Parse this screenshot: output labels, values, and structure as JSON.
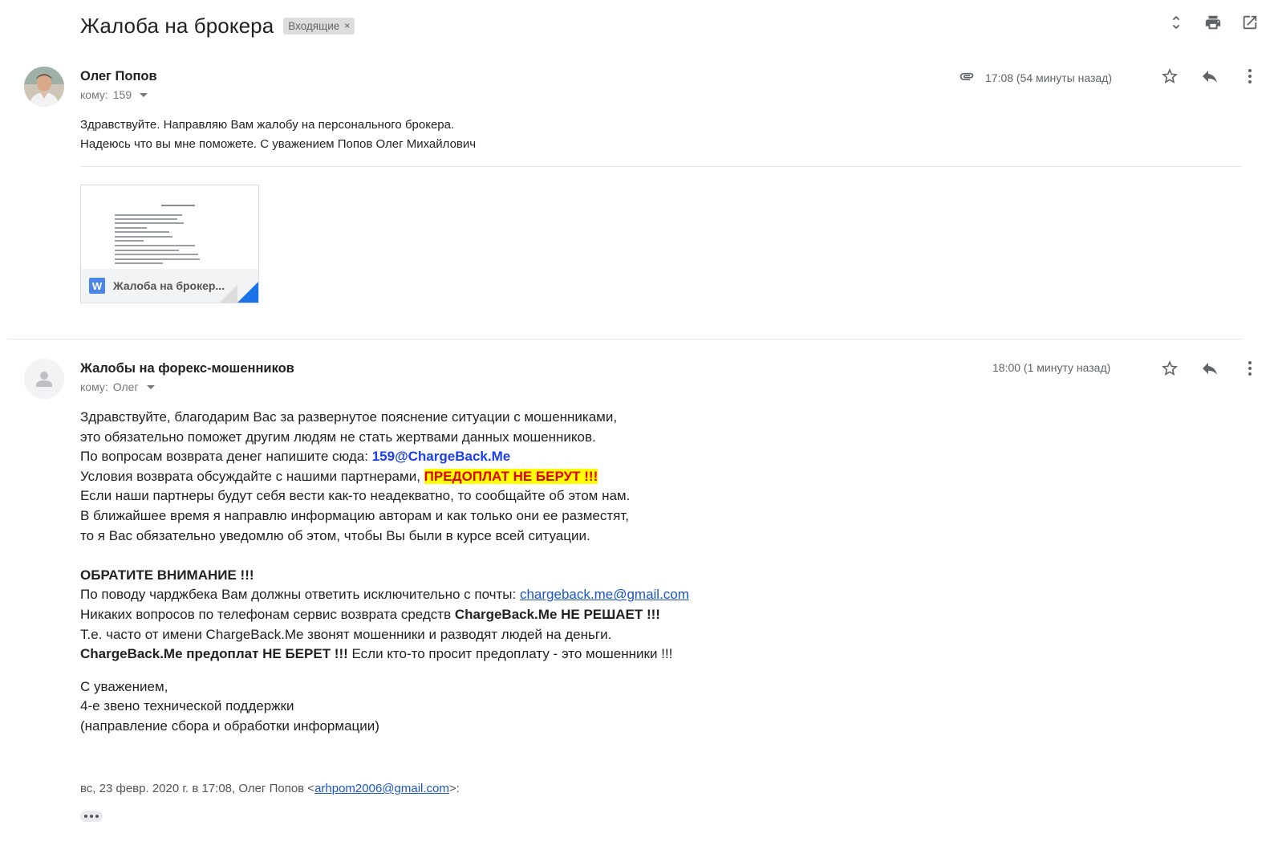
{
  "thread": {
    "subject": "Жалоба на брокера",
    "label_chip": "Входящие",
    "label_remove": "×"
  },
  "message1": {
    "sender": "Олег Попов",
    "recipient_prefix": "кому:",
    "recipient": "159",
    "time": "17:08 (54 минуты назад)",
    "body_lines": [
      "Здравствуйте. Направляю Вам жалобу на персонального брокера.",
      "Надеюсь что вы мне поможете. С уважением Попов Олег Михайлович"
    ],
    "attachment": {
      "type_letter": "W",
      "filename": "Жалоба на брокер..."
    }
  },
  "message2": {
    "sender": "Жалобы на форекс-мошенников",
    "recipient_prefix": "кому:",
    "recipient": "Олег",
    "time": "18:00 (1 минуту назад)",
    "l1": "Здравствуйте, благодарим Вас за развернутое пояснение ситуации с мошенниками,",
    "l2": "это обязательно поможет другим людям не стать жертвами данных мошенников.",
    "l3a": "По вопросам возврата денег напишите сюда: ",
    "l3b": "159@ChargeBack.Me",
    "l4a": "Условия возврата обсуждайте с нашими партнерами, ",
    "l4b": "ПРЕДОПЛАТ НЕ БЕРУТ !!!",
    "l5": "Если наши партнеры будут себя вести как-то неадекватно, то сообщайте об этом нам.",
    "l6": "В ближайшее время я направлю информацию авторам и как только они ее разместят,",
    "l7": "то я Вас обязательно уведомлю об этом, чтобы Вы были в курсе всей ситуации.",
    "l8": "ОБРАТИТЕ ВНИМАНИЕ !!!",
    "l9a": "По поводу чарджбека Вам должны ответить исключительно с почты: ",
    "l9b": "chargeback.me@gmail.com",
    "l10a": "Никаких вопросов по телефонам сервис возврата средств ",
    "l10b": "ChargeBack.Me НЕ РЕШАЕТ !!!",
    "l11": "Т.е. часто от имени ChargeBack.Me звонят мошенники и разводят людей на деньги.",
    "l12a": "ChargeBack.Me предоплат НЕ БЕРЕТ !!!",
    "l12b": " Если кто-то просит предоплату - это мошенники !!!",
    "l13": "С уважением,",
    "l14": "4-е звено технической поддержки",
    "l15": "(направление сбора и обработки информации)",
    "quote_a": "вс, 23 февр. 2020 г. в 17:08, Олег Попов <",
    "quote_link": "arhpom2006@gmail.com",
    "quote_b": ">:"
  },
  "icons": {
    "expand": "unfold-icon",
    "print": "print-icon",
    "newwindow": "open-in-new-icon",
    "attachment": "paperclip-icon",
    "star": "star-icon",
    "reply": "reply-icon",
    "more": "more-vert-icon"
  },
  "colors": {
    "highlight_bg": "#ffff00",
    "highlight_text": "#e00000",
    "link": "#1a56c9",
    "email_blue": "#1a3ee8"
  }
}
